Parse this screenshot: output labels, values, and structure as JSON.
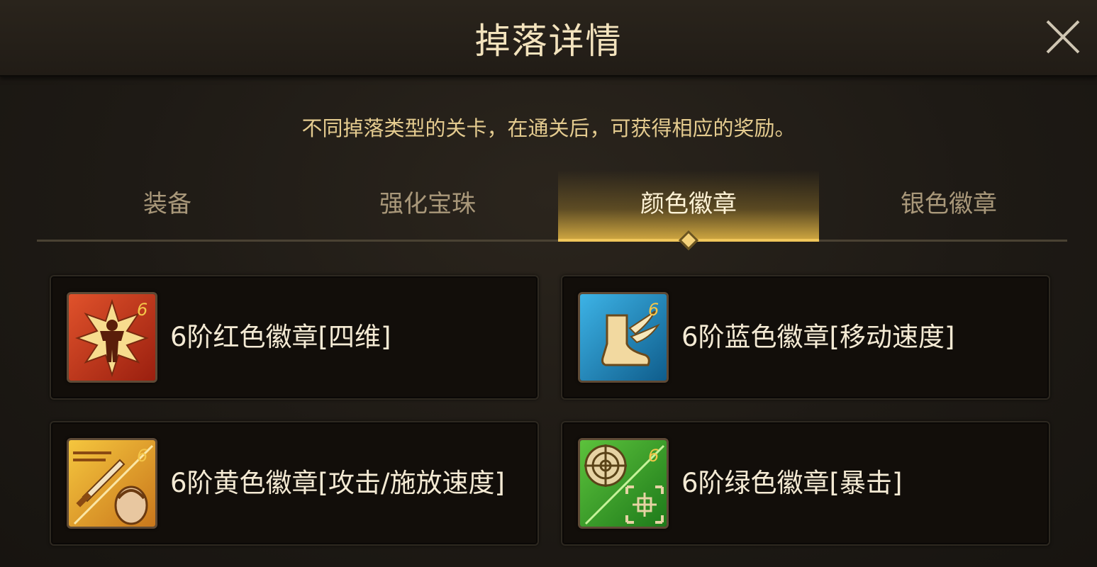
{
  "dialog": {
    "title": "掉落详情",
    "subtitle": "不同掉落类型的关卡，在通关后，可获得相应的奖励。"
  },
  "tabs": [
    {
      "label": "装备",
      "active": false
    },
    {
      "label": "强化宝珠",
      "active": false
    },
    {
      "label": "颜色徽章",
      "active": true
    },
    {
      "label": "银色徽章",
      "active": false
    }
  ],
  "items": [
    {
      "label": "6阶红色徽章[四维]",
      "icon": "red-badge-icon",
      "color": "#c23a1a",
      "tier": "6"
    },
    {
      "label": "6阶蓝色徽章[移动速度]",
      "icon": "blue-badge-icon",
      "color": "#1d8cc4",
      "tier": "6"
    },
    {
      "label": "6阶黄色徽章[攻击/施放速度]",
      "icon": "yellow-badge-icon",
      "color": "#e5a12a",
      "tier": "6"
    },
    {
      "label": "6阶绿色徽章[暴击]",
      "icon": "green-badge-icon",
      "color": "#3fa22b",
      "tier": "6"
    }
  ],
  "colors": {
    "title_text": "#f3e3bd",
    "subtitle_text": "#e4cb8f",
    "tab_active_accent": "#f0c65a",
    "tab_inactive_text": "#a9987a"
  }
}
